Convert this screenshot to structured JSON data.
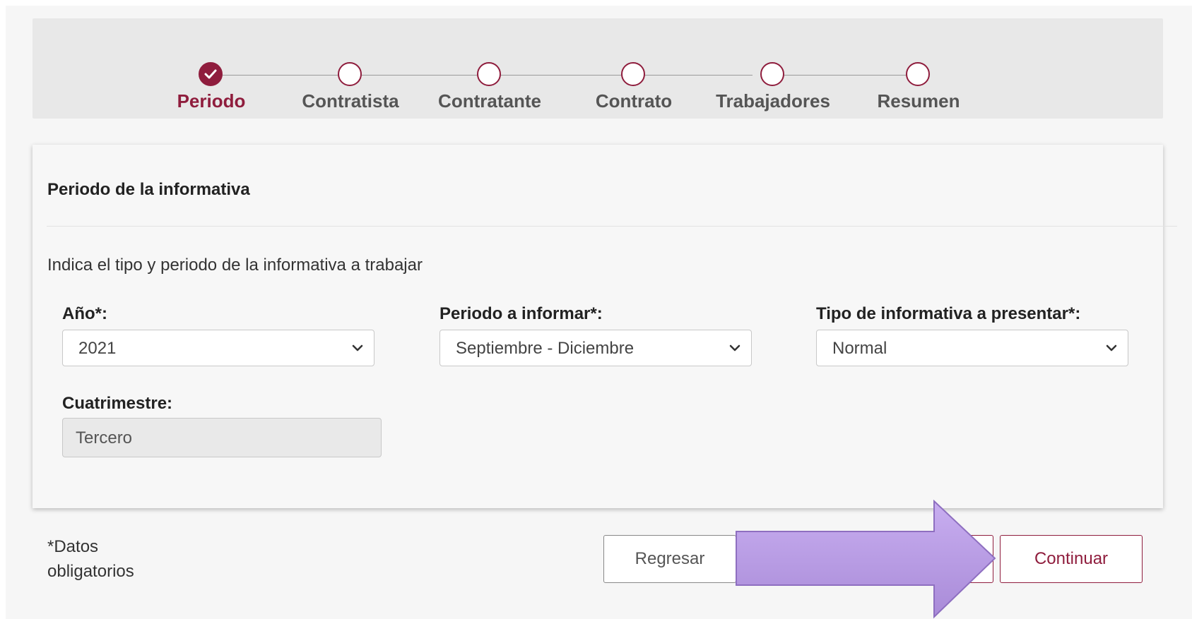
{
  "stepper": {
    "steps": [
      {
        "label": "Periodo",
        "state": "done"
      },
      {
        "label": "Contratista",
        "state": "pending"
      },
      {
        "label": "Contratante",
        "state": "pending"
      },
      {
        "label": "Contrato",
        "state": "pending"
      },
      {
        "label": "Trabajadores",
        "state": "pending"
      },
      {
        "label": "Resumen",
        "state": "pending"
      }
    ]
  },
  "card": {
    "title": "Periodo de la informativa",
    "subtitle": "Indica el tipo y periodo de la informativa a trabajar",
    "fields": {
      "anio": {
        "label": "Año*:",
        "value": "2021"
      },
      "periodo": {
        "label": "Periodo a informar*:",
        "value": "Septiembre - Diciembre"
      },
      "tipo": {
        "label": "Tipo de informativa a presentar*:",
        "value": "Normal"
      },
      "cuatrimestre": {
        "label": "Cuatrimestre:",
        "value": "Tercero"
      }
    }
  },
  "footer": {
    "note_line1": "*Datos",
    "note_line2": "obligatorios",
    "back_label": "Regresar",
    "continue_label": "Continuar"
  },
  "colors": {
    "brand": "#8f1d3d",
    "annotation_arrow": "#b89ae0"
  },
  "icons": {
    "step_done": "check-circle-icon",
    "step_pending": "circle-outline-icon",
    "select": "chevron-down-icon",
    "annotation": "right-arrow-annotation"
  }
}
